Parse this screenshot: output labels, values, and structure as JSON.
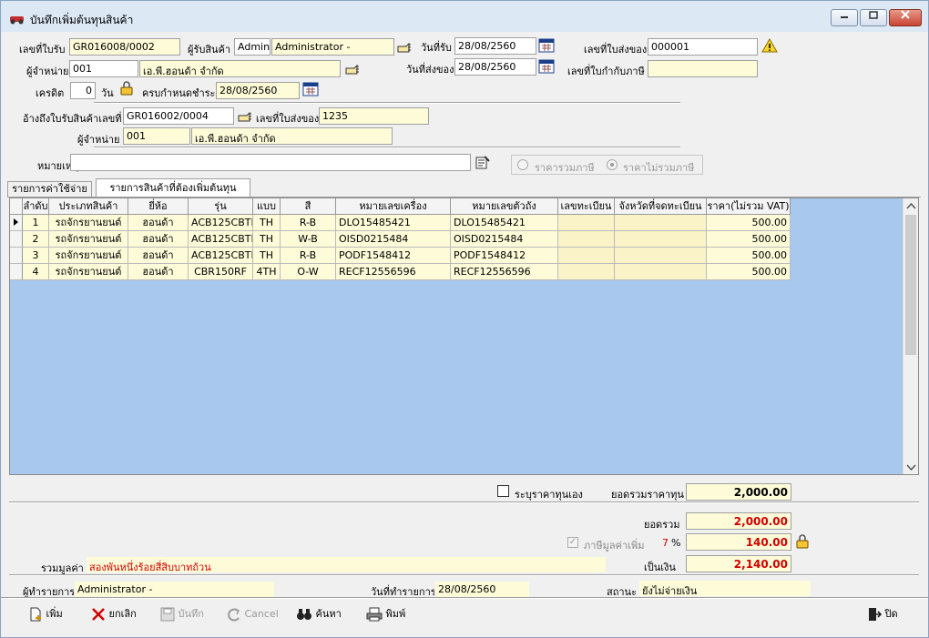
{
  "window": {
    "title": "บันทึกเพิ่มต้นทุนสินค้า"
  },
  "header": {
    "receipt_no_label": "เลขที่ใบรับ",
    "receipt_no": "GR016008/0002",
    "receiver_label": "ผู้รับสินค้า",
    "receiver_code": "Admin",
    "receiver_name": "Administrator -",
    "receive_date_label": "วันที่รับ",
    "receive_date": "28/08/2560",
    "delivery_no_label": "เลขที่ใบส่งของ",
    "delivery_no": "000001",
    "supplier_label": "ผู้จำหน่าย",
    "supplier_code": "001",
    "supplier_name": "เอ.พี.ฮอนด้า จำกัด",
    "delivery_date_label": "วันที่ส่งของ",
    "delivery_date": "28/08/2560",
    "tax_invoice_label": "เลขที่ใบกำกับภาษี",
    "tax_invoice": "",
    "credit_label": "เครดิต",
    "credit": "0",
    "day_label": "วัน",
    "due_label": "ครบกำหนดชำระ",
    "due_date": "28/08/2560",
    "ref_receipt_label": "อ้างถึงใบรับสินค้าเลขที่",
    "ref_receipt": "GR016002/0004",
    "ref_delivery_label": "เลขที่ใบส่งของ",
    "ref_delivery": "1235",
    "ref_supplier_label": "ผู้จำหน่าย",
    "ref_supplier_code": "001",
    "ref_supplier_name": "เอ.พี.ฮอนด้า จำกัด",
    "remark_label": "หมายเหตุ",
    "remark": "",
    "radio_incl": "ราคารวมภาษี",
    "radio_excl": "ราคาไม่รวมภาษี"
  },
  "tabs": [
    {
      "label": "รายการค่าใช้จ่าย"
    },
    {
      "label": "รายการสินค้าที่ต้องเพิ่มต้นทุน"
    }
  ],
  "table": {
    "headers": [
      "ลำดับ",
      "ประเภทสินค้า",
      "ยี่ห้อ",
      "รุ่น",
      "แบบ",
      "สี",
      "หมายเลขเครื่อง",
      "หมายเลขตัวถัง",
      "เลขทะเบียน",
      "จังหวัดที่จดทะเบียน",
      "ราคา(ไม่รวม VAT)"
    ],
    "rows": [
      [
        "1",
        "รถจักรยานยนต์",
        "ฮอนด้า",
        "ACB125CBTE",
        "TH",
        "R-B",
        "DLO15485421",
        "DLO15485421",
        "",
        "",
        "500.00"
      ],
      [
        "2",
        "รถจักรยานยนต์",
        "ฮอนด้า",
        "ACB125CBTE",
        "TH",
        "W-B",
        "OISD0215484",
        "OISD0215484",
        "",
        "",
        "500.00"
      ],
      [
        "3",
        "รถจักรยานยนต์",
        "ฮอนด้า",
        "ACB125CBTE",
        "TH",
        "R-B",
        "PODF1548412",
        "PODF1548412",
        "",
        "",
        "500.00"
      ],
      [
        "4",
        "รถจักรยานยนต์",
        "ฮอนด้า",
        "CBR150RF",
        "4TH",
        "O-W",
        "RECF12556596",
        "RECF12556596",
        "",
        "",
        "500.00"
      ]
    ]
  },
  "totals": {
    "specify_cost_label": "ระบุราคาทุนเอง",
    "cost_total_label": "ยอดรวมราคาทุน",
    "cost_total": "2,000.00",
    "sum_label": "ยอดรวม",
    "sum": "2,000.00",
    "vat_label": "ภาษีมูลค่าเพิ่ม",
    "vat_rate": "7",
    "vat_unit": "%",
    "vat": "140.00",
    "total_words_label": "รวมมูลค่า",
    "total_words": "สองพันหนึ่งร้อยสี่สิบบาทถ้วน",
    "net_label": "เป็นเงิน",
    "net": "2,140.00"
  },
  "status": {
    "operator_label": "ผู้ทำรายการ",
    "operator": "Administrator -",
    "date_label": "วันที่ทำรายการ",
    "date": "28/08/2560",
    "state_label": "สถานะ",
    "state": "ยังไม่จ่ายเงิน"
  },
  "toolbar": {
    "add": "เพิ่ม",
    "cancel_doc": "ยกเลิก",
    "save": "บันทึก",
    "cancel": "Cancel",
    "search": "ค้นหา",
    "print": "พิมพ์",
    "close": "ปิด"
  },
  "colors": {
    "field_yellow": "#fdfbd8",
    "grid_bg": "#a8c8ee",
    "red_text": "#d00000"
  }
}
